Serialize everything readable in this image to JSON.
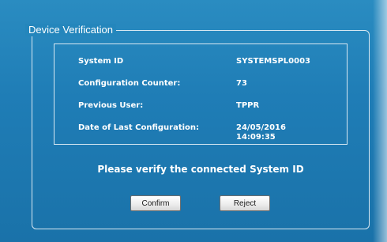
{
  "dialog": {
    "group_title": "Device Verification",
    "fields": [
      {
        "label": "System ID",
        "value": "SYSTEMSPL0003"
      },
      {
        "label": "Configuration Counter:",
        "value": "73"
      },
      {
        "label": "Previous User:",
        "value": "TPPR"
      },
      {
        "label": "Date of Last Configuration:",
        "value_date": "24/05/2016",
        "value_time": "14:09:35"
      }
    ],
    "prompt": "Please verify the connected System ID",
    "confirm_label": "Confirm",
    "reject_label": "Reject"
  }
}
